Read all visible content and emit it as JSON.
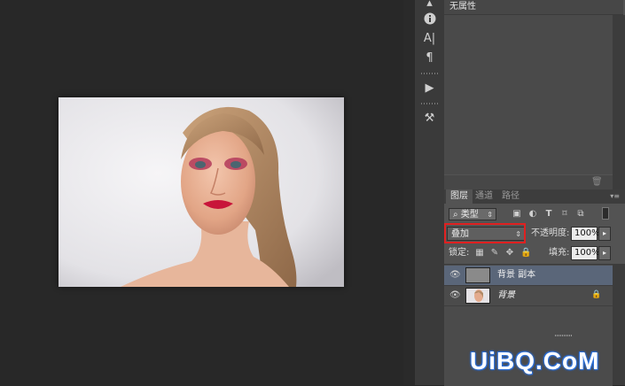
{
  "properties_panel": {
    "title": "无属性"
  },
  "layers_panel": {
    "tabs": [
      "图层",
      "通道",
      "路径"
    ],
    "filter": {
      "search_icon": "magnifier-icon",
      "value": "类型"
    },
    "blend_mode": {
      "value": "叠加",
      "highlight_color": "#e02020"
    },
    "opacity": {
      "label": "不透明度:",
      "value": "100%"
    },
    "lock": {
      "label": "锁定:"
    },
    "fill": {
      "label": "填充:",
      "value": "100%"
    },
    "layers": [
      {
        "name": "背景 副本",
        "selected": true,
        "thumbnail": "gray"
      },
      {
        "name": "背景",
        "selected": false,
        "thumbnail": "portrait",
        "locked": true
      }
    ]
  },
  "watermark": {
    "text": "UiBQ.CoM",
    "color": "#2c6fd8"
  }
}
